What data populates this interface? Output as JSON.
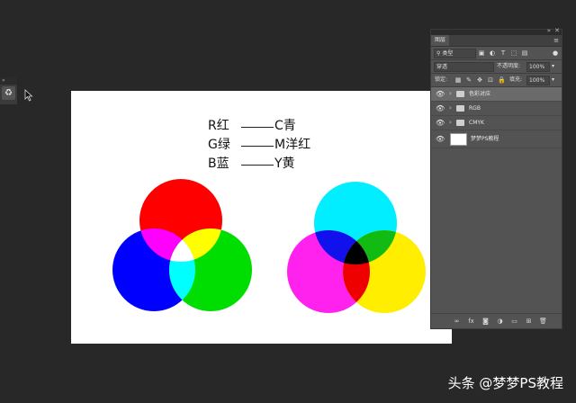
{
  "canvas_labels": {
    "line1_left": "R红",
    "line1_right": "C青",
    "line2_left": "G绿",
    "line2_right": "M洋红",
    "line3_left": "B蓝",
    "line3_right": "Y黄"
  },
  "colors": {
    "red": "#ff0000",
    "green": "#00ff00",
    "blue": "#0000ff",
    "cyan": "#00ffff",
    "magenta": "#ff00ff",
    "yellow": "#ffff00",
    "panel_bg": "#535353",
    "app_bg": "#282828"
  },
  "layers_panel": {
    "tab_label": "图层",
    "filter_kind": "类型",
    "blend_mode": "穿透",
    "opacity_label": "不透明度:",
    "opacity_value": "100%",
    "lock_label": "锁定:",
    "fill_label": "填充:",
    "fill_value": "100%",
    "layers": [
      {
        "name": "色彩对应",
        "type": "group",
        "selected": true
      },
      {
        "name": "RGB",
        "type": "group",
        "selected": false
      },
      {
        "name": "CMYK",
        "type": "group",
        "selected": false
      },
      {
        "name": "梦梦PS教程",
        "type": "background",
        "selected": false
      }
    ],
    "bottom_icons": [
      "link-icon",
      "fx-icon",
      "mask-icon",
      "adjustment-icon",
      "folder-icon",
      "new-layer-icon",
      "trash-icon"
    ],
    "fx_label": "fx"
  },
  "watermark": "头条 @梦梦PS教程"
}
